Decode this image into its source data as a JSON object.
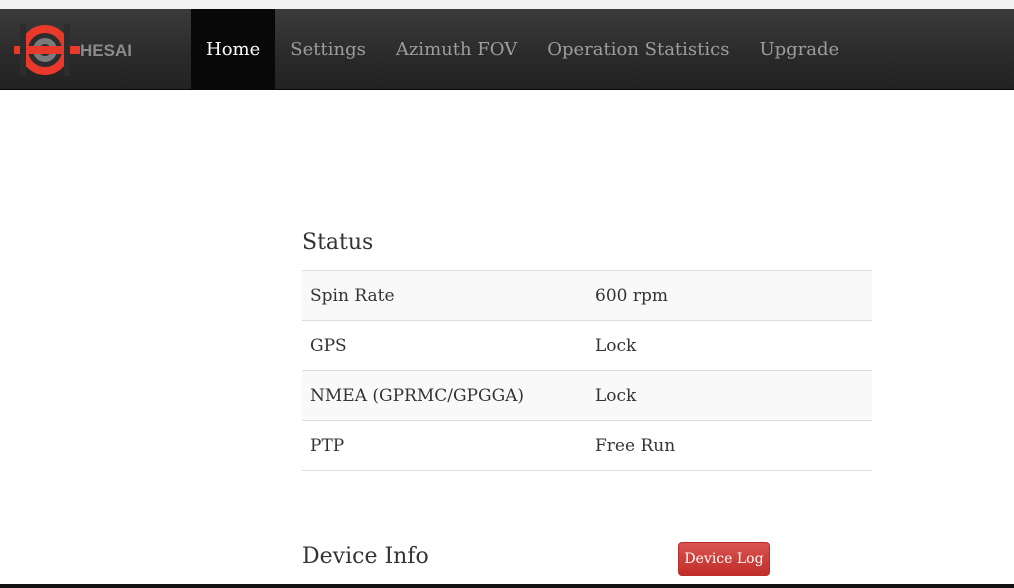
{
  "brand": {
    "logo_text": "HESAI",
    "logo_color": "#e8392a"
  },
  "nav": {
    "items": [
      {
        "label": "Home",
        "active": true
      },
      {
        "label": "Settings",
        "active": false
      },
      {
        "label": "Azimuth FOV",
        "active": false
      },
      {
        "label": "Operation Statistics",
        "active": false
      },
      {
        "label": "Upgrade",
        "active": false
      }
    ]
  },
  "status": {
    "title": "Status",
    "rows": [
      {
        "label": "Spin Rate",
        "value": "600 rpm"
      },
      {
        "label": "GPS",
        "value": "Lock"
      },
      {
        "label": "NMEA (GPRMC/GPGGA)",
        "value": "Lock"
      },
      {
        "label": "PTP",
        "value": "Free Run"
      }
    ]
  },
  "device_info": {
    "title": "Device Info",
    "log_button_label": "Device Log"
  },
  "colors": {
    "navbar": "#2a2a2a",
    "nav_active": "#080808",
    "button_danger": "#d9534f"
  }
}
